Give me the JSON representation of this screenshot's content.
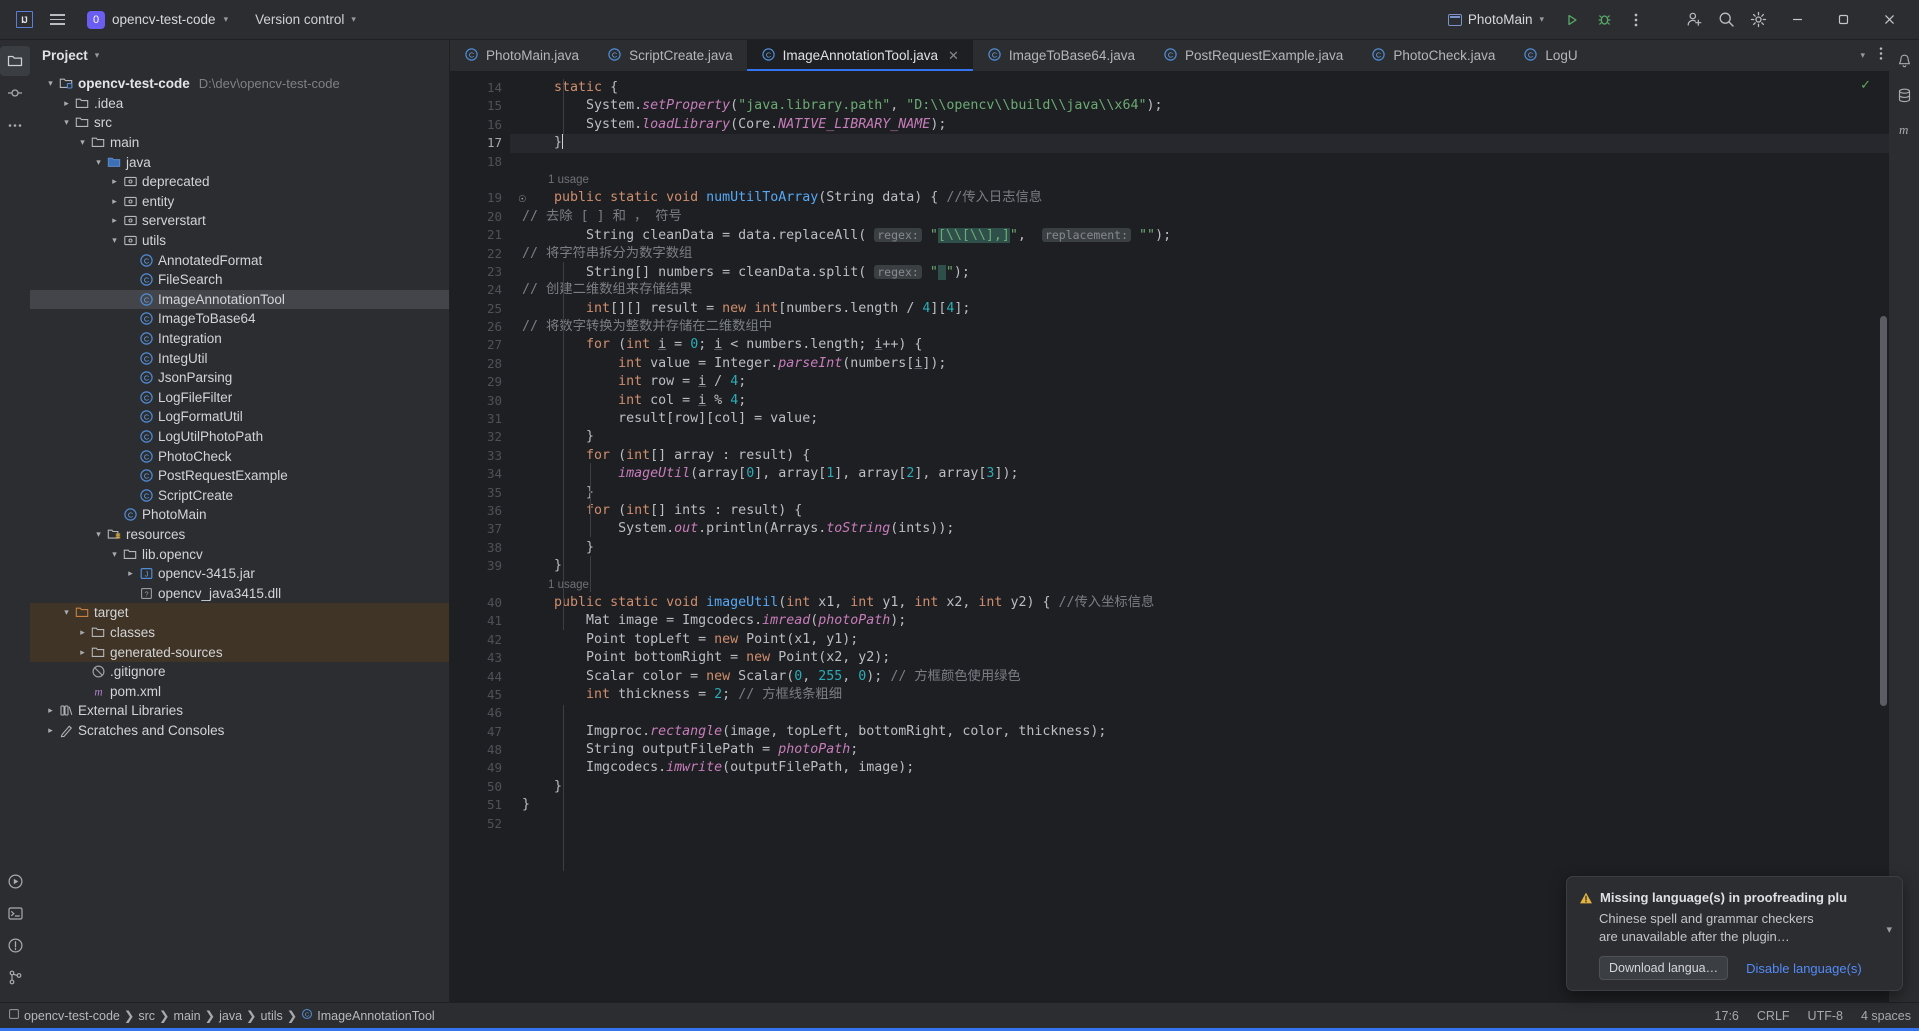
{
  "titlebar": {
    "logo_text": "IJ",
    "menu_icon": "hamburger-icon",
    "project_badge": "0",
    "project_name": "opencv-test-code",
    "vcs_label": "Version control",
    "run_config": "PhotoMain",
    "run_icon": "run-icon",
    "debug_icon": "debug-icon",
    "more_icon": "more-vertical-icon",
    "account_icon": "add-user-icon",
    "search_icon": "search-icon",
    "settings_icon": "gear-icon",
    "minimize": "minimize-icon",
    "maximize": "maximize-icon",
    "close": "close-icon"
  },
  "project_panel": {
    "title": "Project",
    "tree": [
      {
        "depth": 0,
        "arrow": "down",
        "icon": "module-folder",
        "label": "opencv-test-code",
        "bold": true,
        "path": "D:\\dev\\opencv-test-code"
      },
      {
        "depth": 1,
        "arrow": "right",
        "icon": "folder",
        "label": ".idea"
      },
      {
        "depth": 1,
        "arrow": "down",
        "icon": "folder",
        "label": "src"
      },
      {
        "depth": 2,
        "arrow": "down",
        "icon": "folder",
        "label": "main"
      },
      {
        "depth": 3,
        "arrow": "down",
        "icon": "source-folder",
        "label": "java"
      },
      {
        "depth": 4,
        "arrow": "right",
        "icon": "package",
        "label": "deprecated"
      },
      {
        "depth": 4,
        "arrow": "right",
        "icon": "package",
        "label": "entity"
      },
      {
        "depth": 4,
        "arrow": "right",
        "icon": "package",
        "label": "serverstart"
      },
      {
        "depth": 4,
        "arrow": "down",
        "icon": "package",
        "label": "utils"
      },
      {
        "depth": 5,
        "arrow": "none",
        "icon": "class",
        "label": "AnnotatedFormat"
      },
      {
        "depth": 5,
        "arrow": "none",
        "icon": "class",
        "label": "FileSearch"
      },
      {
        "depth": 5,
        "arrow": "none",
        "icon": "class",
        "label": "ImageAnnotationTool",
        "selected": true
      },
      {
        "depth": 5,
        "arrow": "none",
        "icon": "class",
        "label": "ImageToBase64"
      },
      {
        "depth": 5,
        "arrow": "none",
        "icon": "class",
        "label": "Integration"
      },
      {
        "depth": 5,
        "arrow": "none",
        "icon": "class",
        "label": "IntegUtil"
      },
      {
        "depth": 5,
        "arrow": "none",
        "icon": "class",
        "label": "JsonParsing"
      },
      {
        "depth": 5,
        "arrow": "none",
        "icon": "class",
        "label": "LogFileFilter"
      },
      {
        "depth": 5,
        "arrow": "none",
        "icon": "class",
        "label": "LogFormatUtil"
      },
      {
        "depth": 5,
        "arrow": "none",
        "icon": "class",
        "label": "LogUtilPhotoPath"
      },
      {
        "depth": 5,
        "arrow": "none",
        "icon": "class",
        "label": "PhotoCheck"
      },
      {
        "depth": 5,
        "arrow": "none",
        "icon": "class",
        "label": "PostRequestExample"
      },
      {
        "depth": 5,
        "arrow": "none",
        "icon": "class",
        "label": "ScriptCreate"
      },
      {
        "depth": 4,
        "arrow": "none",
        "icon": "class",
        "label": "PhotoMain"
      },
      {
        "depth": 3,
        "arrow": "down",
        "icon": "resource-folder",
        "label": "resources"
      },
      {
        "depth": 4,
        "arrow": "down",
        "icon": "folder",
        "label": "lib.opencv"
      },
      {
        "depth": 5,
        "arrow": "right",
        "icon": "jar",
        "label": "opencv-3415.jar"
      },
      {
        "depth": 5,
        "arrow": "none",
        "icon": "file",
        "label": "opencv_java3415.dll"
      },
      {
        "depth": 1,
        "arrow": "down",
        "icon": "excluded-folder",
        "label": "target",
        "target": true
      },
      {
        "depth": 2,
        "arrow": "right",
        "icon": "folder",
        "label": "classes",
        "target": true
      },
      {
        "depth": 2,
        "arrow": "right",
        "icon": "folder",
        "label": "generated-sources",
        "target": true
      },
      {
        "depth": 2,
        "arrow": "none",
        "icon": "gitignore",
        "label": ".gitignore"
      },
      {
        "depth": 2,
        "arrow": "none",
        "icon": "maven",
        "label": "pom.xml"
      },
      {
        "depth": 0,
        "arrow": "right",
        "icon": "library",
        "label": "External Libraries"
      },
      {
        "depth": 0,
        "arrow": "right",
        "icon": "scratches",
        "label": "Scratches and Consoles"
      }
    ]
  },
  "editor_tabs": [
    {
      "label": "PhotoMain.java",
      "icon": "class-icon",
      "active": false
    },
    {
      "label": "ScriptCreate.java",
      "icon": "class-icon",
      "active": false
    },
    {
      "label": "ImageAnnotationTool.java",
      "icon": "class-icon",
      "active": true,
      "closable": true
    },
    {
      "label": "ImageToBase64.java",
      "icon": "class-icon",
      "active": false
    },
    {
      "label": "PostRequestExample.java",
      "icon": "class-icon",
      "active": false
    },
    {
      "label": "PhotoCheck.java",
      "icon": "class-icon",
      "active": false
    },
    {
      "label": "LogU",
      "icon": "class-icon",
      "active": false
    }
  ],
  "tabs_controls": {
    "chevron": "chevron-down-icon",
    "more": "more-vertical-icon"
  },
  "editor": {
    "file": "ImageAnnotationTool.java",
    "first_line": 14,
    "current_line": 17,
    "inspection_status": "ok-checkmark",
    "lines": [
      {
        "n": 14,
        "html": "    <span class='kw'>static</span> {"
      },
      {
        "n": 15,
        "html": "        System.<span class='stat'>setProperty</span>(<span class='str'>\"java.library.path\"</span>, <span class='str'>\"D:\\\\opencv\\\\build\\\\java\\\\x64\"</span>);"
      },
      {
        "n": 16,
        "html": "        System.<span class='stat'>loadLibrary</span>(Core.<span class='fld'>NATIVE_LIBRARY_NAME</span>);"
      },
      {
        "n": 17,
        "html": "    }<span class='caret'></span>",
        "current": true
      },
      {
        "n": 18,
        "html": ""
      },
      {
        "n": 19,
        "html": "    <span class='kw'>public static void</span> <span class='fn'>numUtilToArray</span>(String data) { <span class='cmt'>//传入日志信息</span>",
        "usage": "1 usage",
        "gutter_icon": "override-icon"
      },
      {
        "n": 20,
        "html": "<span class='cmt'>// 去除 [ ] 和 ， 符号</span>"
      },
      {
        "n": 21,
        "html": "        String cleanData = data.replaceAll( <span class='hint'>regex:</span> <span class='str'>\"</span><span class='str hl'>[\\\\[\\\\],]</span><span class='str'>\"</span>,  <span class='hint'>replacement:</span> <span class='str'>\"\"</span>);"
      },
      {
        "n": 22,
        "html": "<span class='cmt'>// 将字符串拆分为数字数组</span>"
      },
      {
        "n": 23,
        "html": "        String[] numbers = cleanData.split( <span class='hint'>regex:</span> <span class='str'>\"</span><span class='str hl'> </span><span class='str'>\"</span>);"
      },
      {
        "n": 24,
        "html": "<span class='cmt'>// 创建二维数组来存储结果</span>"
      },
      {
        "n": 25,
        "html": "        <span class='kw'>int</span>[][] result = <span class='kw'>new</span> <span class='kw'>int</span>[numbers.length / <span class='num'>4</span>][<span class='num'>4</span>];"
      },
      {
        "n": 26,
        "html": "<span class='cmt'>// 将数字转换为整数并存储在二维数组中</span>"
      },
      {
        "n": 27,
        "html": "        <span class='kw'>for</span> (<span class='kw'>int</span> <span class='und'>i</span> = <span class='num'>0</span>; <span class='und'>i</span> &lt; numbers.length; <span class='und'>i</span>++) {"
      },
      {
        "n": 28,
        "html": "            <span class='kw'>int</span> value = Integer.<span class='stat'>parseInt</span>(numbers[<span class='und'>i</span>]);"
      },
      {
        "n": 29,
        "html": "            <span class='kw'>int</span> row = <span class='und'>i</span> / <span class='num'>4</span>;"
      },
      {
        "n": 30,
        "html": "            <span class='kw'>int</span> col = <span class='und'>i</span> % <span class='num'>4</span>;"
      },
      {
        "n": 31,
        "html": "            result[row][col] = value;"
      },
      {
        "n": 32,
        "html": "        }"
      },
      {
        "n": 33,
        "html": "        <span class='kw'>for</span> (<span class='kw'>int</span>[] array : result) {"
      },
      {
        "n": 34,
        "html": "            <span class='stat'>imageUtil</span>(array[<span class='num'>0</span>], array[<span class='num'>1</span>], array[<span class='num'>2</span>], array[<span class='num'>3</span>]);"
      },
      {
        "n": 35,
        "html": "        }"
      },
      {
        "n": 36,
        "html": "        <span class='kw'>for</span> (<span class='kw'>int</span>[] ints : result) {"
      },
      {
        "n": 37,
        "html": "            System.<span class='stat'>out</span>.println(Arrays.<span class='stat'>toString</span>(ints));"
      },
      {
        "n": 38,
        "html": "        }"
      },
      {
        "n": 39,
        "html": "    }"
      },
      {
        "n": 40,
        "html": "    <span class='kw'>public static void</span> <span class='fn'>imageUtil</span>(<span class='kw'>int</span> x1, <span class='kw'>int</span> y1, <span class='kw'>int</span> x2, <span class='kw'>int</span> y2) { <span class='cmt'>//传入坐标信息</span>",
        "usage": "1 usage"
      },
      {
        "n": 41,
        "html": "        Mat image = Imgcodecs.<span class='stat'>imread</span>(<span class='fld'>photoPath</span>);"
      },
      {
        "n": 42,
        "html": "        Point topLeft = <span class='kw'>new</span> Point(x1, y1);"
      },
      {
        "n": 43,
        "html": "        Point bottomRight = <span class='kw'>new</span> Point(x2, y2);"
      },
      {
        "n": 44,
        "html": "        Scalar color = <span class='kw'>new</span> Scalar(<span class='num'>0</span>, <span class='num'>255</span>, <span class='num'>0</span>); <span class='cmt'>// 方框颜色使用绿色</span>"
      },
      {
        "n": 45,
        "html": "        <span class='kw'>int</span> thickness = <span class='num'>2</span>; <span class='cmt'>// 方框线条粗细</span>"
      },
      {
        "n": 46,
        "html": ""
      },
      {
        "n": 47,
        "html": "        Imgproc.<span class='stat'>rectangle</span>(image, topLeft, bottomRight, color, thickness);"
      },
      {
        "n": 48,
        "html": "        String outputFilePath = <span class='fld'>photoPath</span>;"
      },
      {
        "n": 49,
        "html": "        Imgcodecs.<span class='stat'>imwrite</span>(outputFilePath, image);"
      },
      {
        "n": 50,
        "html": "    }"
      },
      {
        "n": 51,
        "html": "}"
      },
      {
        "n": 52,
        "html": ""
      }
    ]
  },
  "notification": {
    "warn_icon": "warning-icon",
    "title": "Missing language(s) in proofreading plu",
    "body_line1": "Chinese spell and grammar checkers",
    "body_line2": "are unavailable after the plugin…",
    "primary_button": "Download langua…",
    "secondary_link": "Disable language(s)",
    "collapse_icon": "chevron-down-icon"
  },
  "statusbar": {
    "breadcrumbs": [
      {
        "label": "opencv-test-code",
        "icon": "module-icon"
      },
      {
        "label": "src",
        "icon": "none"
      },
      {
        "label": "main",
        "icon": "none"
      },
      {
        "label": "java",
        "icon": "none"
      },
      {
        "label": "utils",
        "icon": "none"
      },
      {
        "label": "ImageAnnotationTool",
        "icon": "class-icon"
      }
    ],
    "caret_position": "17:6",
    "line_separator": "CRLF",
    "encoding": "UTF-8",
    "indent": "4 spaces"
  },
  "left_rail": [
    {
      "icon": "project-folder-icon",
      "active": true
    },
    {
      "icon": "commit-icon",
      "active": false
    },
    {
      "icon": "more-dots-icon",
      "active": false
    }
  ],
  "left_rail_bottom": [
    {
      "icon": "run-panel-icon"
    },
    {
      "icon": "terminal-icon"
    },
    {
      "icon": "problems-icon"
    },
    {
      "icon": "git-branch-icon"
    }
  ],
  "right_rail": [
    {
      "icon": "notifications-bell-icon"
    },
    {
      "icon": "database-icon"
    },
    {
      "icon": "maven-m-icon"
    }
  ],
  "colors": {
    "accent": "#3574f0",
    "selection": "#43454a",
    "excluded": "#3f3426",
    "titlebar_bg": "#2b2d30",
    "editor_bg": "#1e1f22",
    "warning": "#e3b341",
    "link": "#548af7"
  }
}
